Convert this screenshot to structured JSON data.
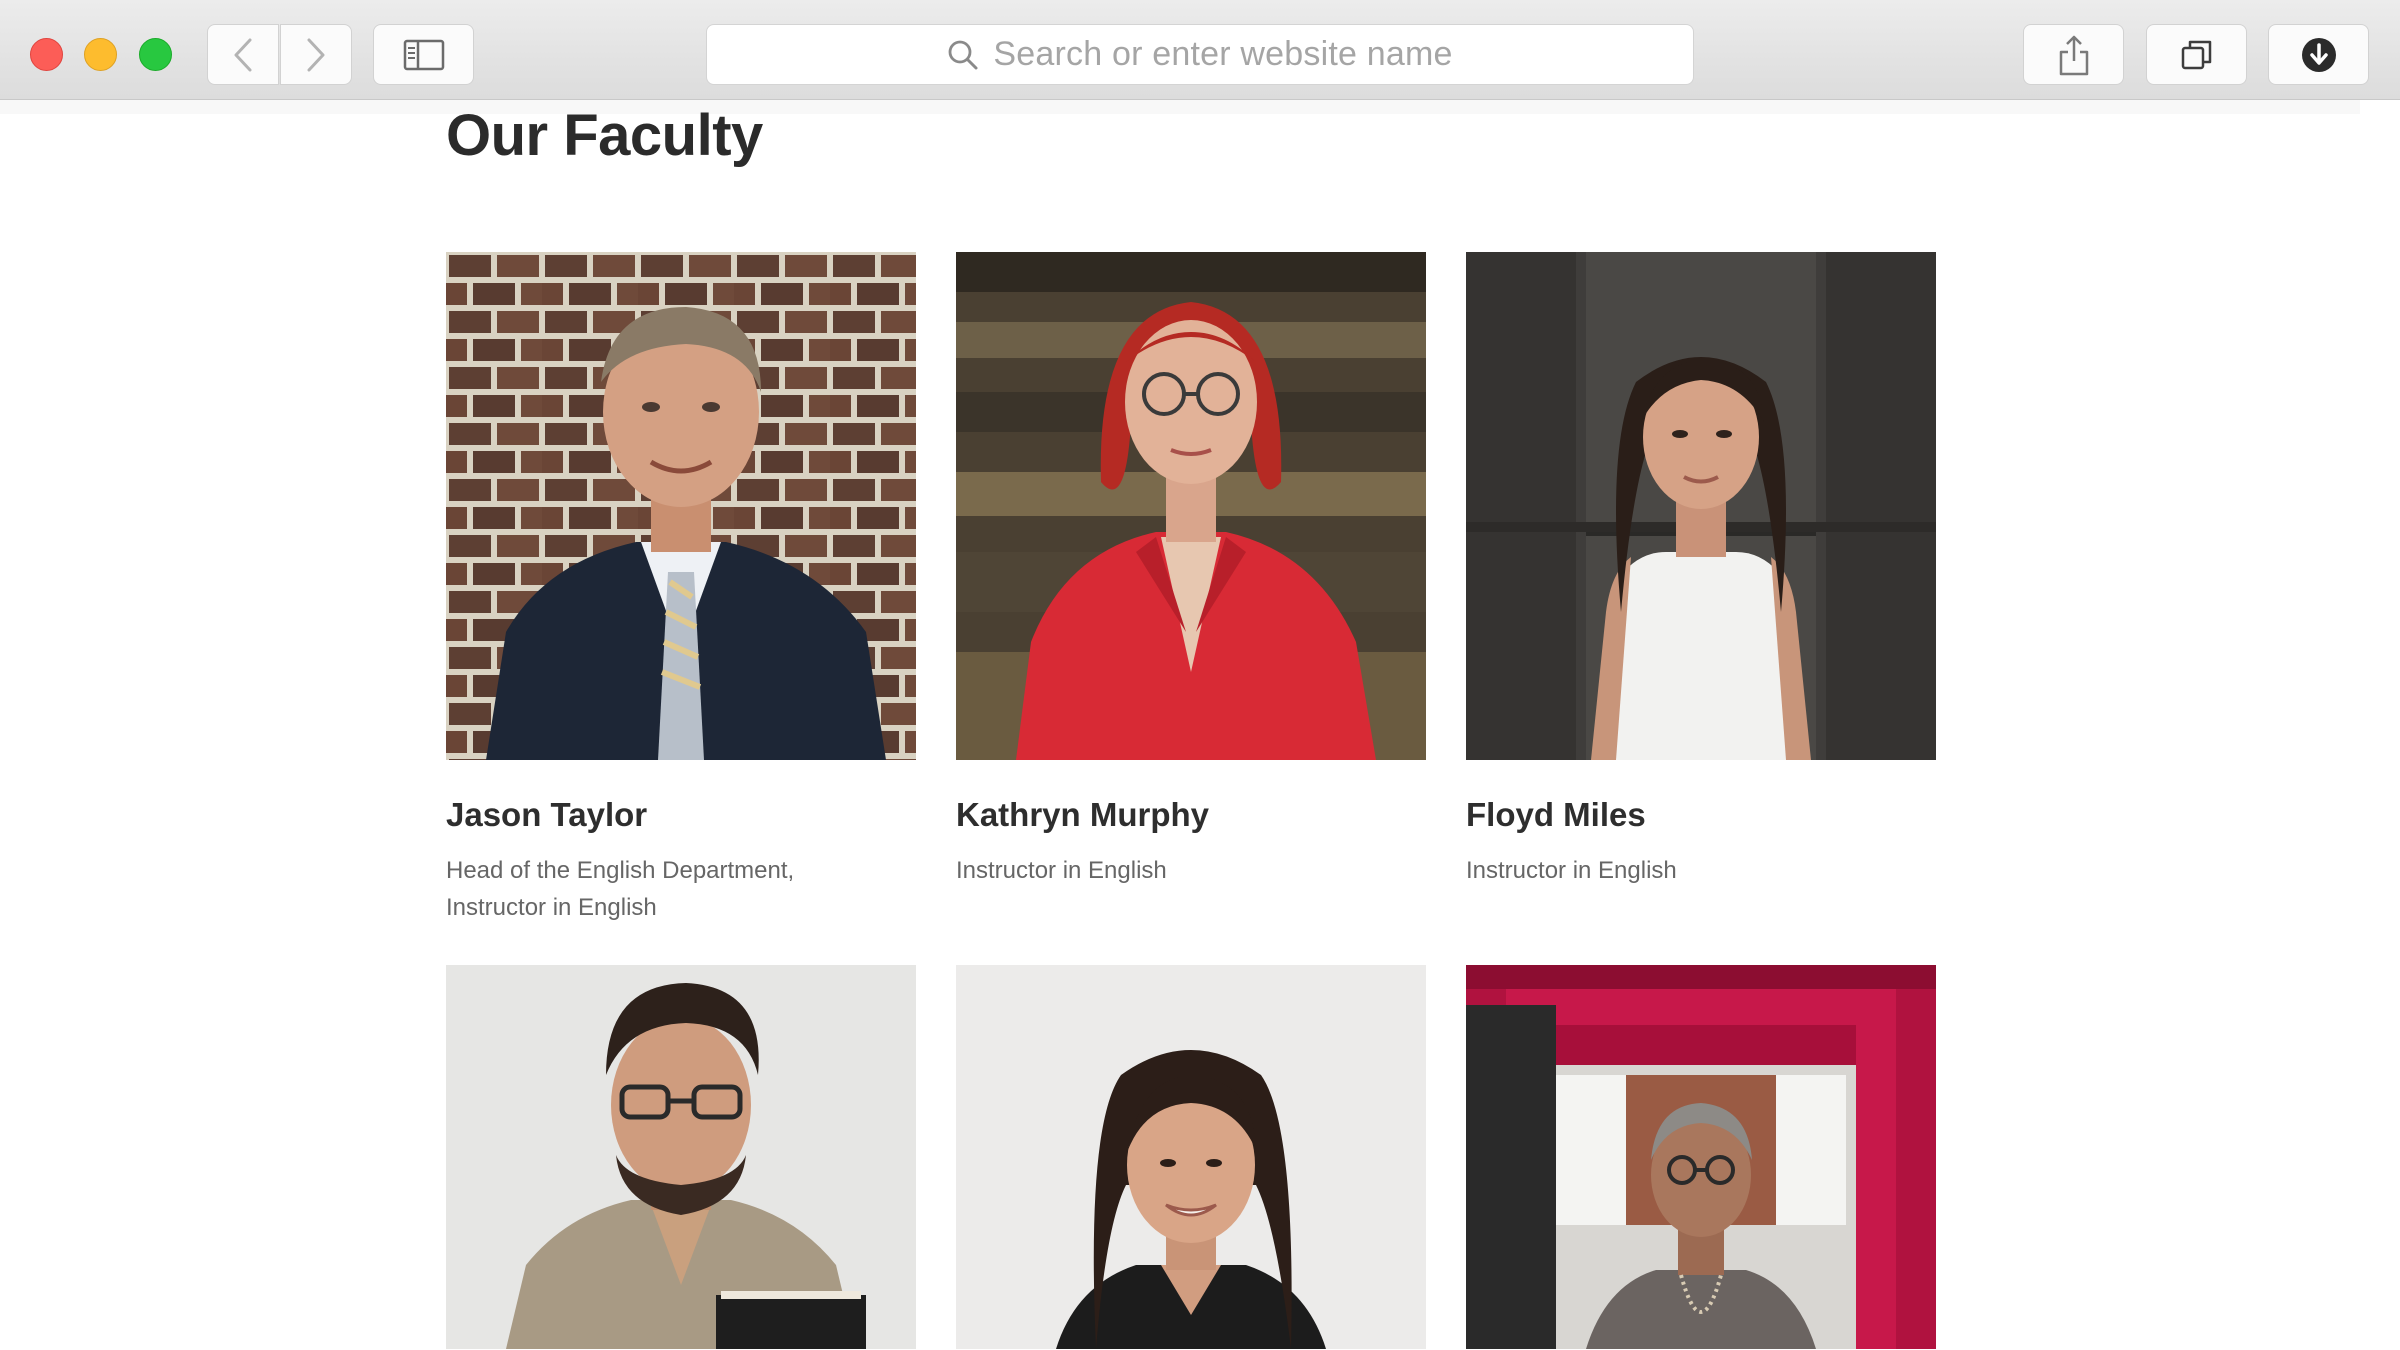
{
  "browser": {
    "address_placeholder": "Search or enter website name"
  },
  "page": {
    "title": "Our Faculty"
  },
  "faculty": [
    {
      "name": "Jason Taylor",
      "role": "Head of the English Department, Instructor in English"
    },
    {
      "name": "Kathryn Murphy",
      "role": "Instructor in English"
    },
    {
      "name": "Floyd Miles",
      "role": "Instructor in English"
    },
    {
      "name": "",
      "role": ""
    },
    {
      "name": "",
      "role": ""
    },
    {
      "name": "",
      "role": ""
    }
  ],
  "colors": {
    "toolbar": "#dcdcdc",
    "close": "#fc5d57",
    "minimize": "#fdbc2e",
    "zoom": "#28c840",
    "heading": "#2b2b2b",
    "body_text": "#666666"
  },
  "icons": [
    "back-chevron-icon",
    "forward-chevron-icon",
    "sidebar-icon",
    "search-icon",
    "share-icon",
    "tabs-icon",
    "download-icon"
  ]
}
